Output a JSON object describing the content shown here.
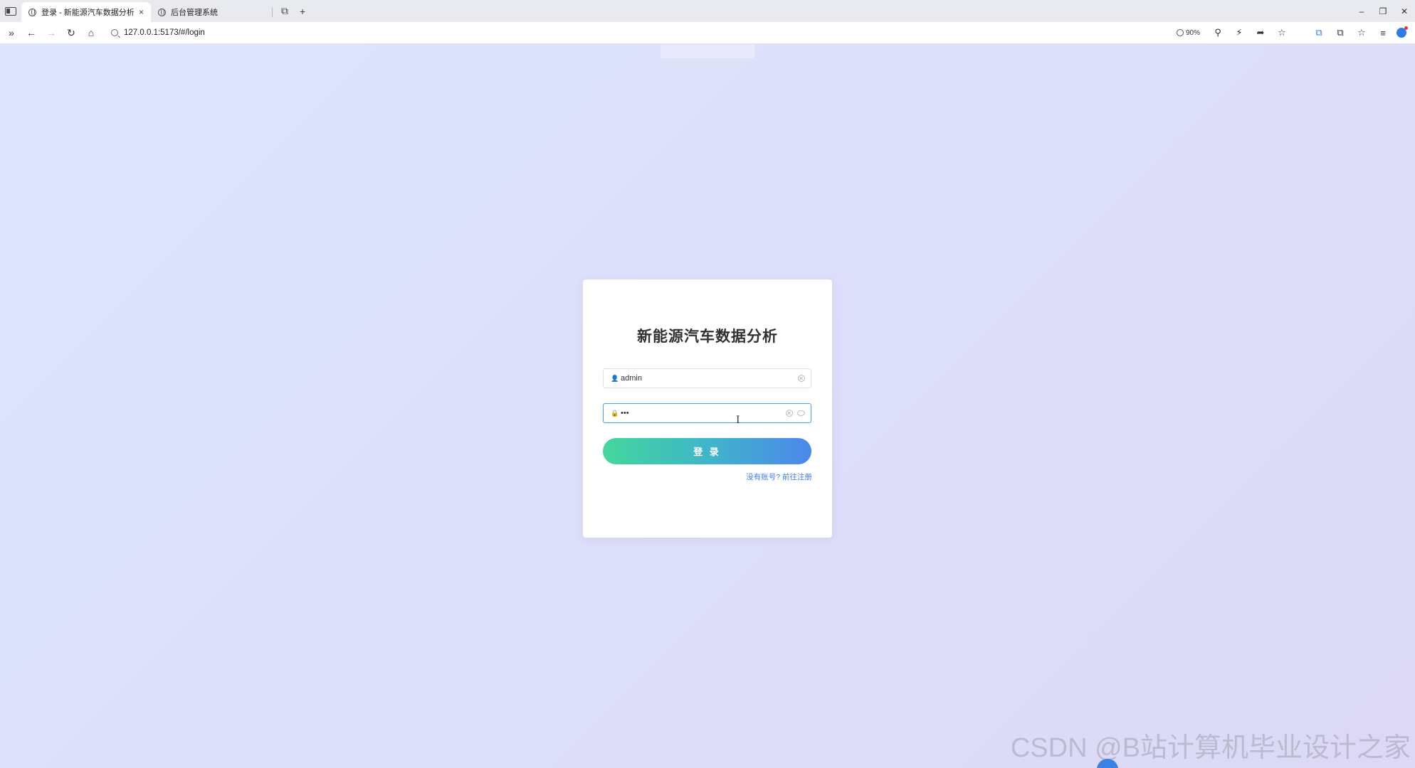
{
  "browser": {
    "tabs": [
      {
        "title": "登录 - 新能源汽车数据分析",
        "active": true
      },
      {
        "title": "后台管理系统",
        "active": false
      }
    ],
    "url": "127.0.0.1:5173/#/login",
    "zoom": "90%",
    "icons": {
      "sidebar": "sidebar-toggle-icon",
      "close": "×",
      "new_tab": "+",
      "tab_overview": "⧉",
      "forward_double": "»",
      "back": "←",
      "forward": "→",
      "reload": "↻",
      "home": "⌂",
      "minimize": "–",
      "restore": "❐",
      "window_close": "✕",
      "pin": "⚲",
      "bolt": "⚡",
      "share": "➦",
      "star_add": "☆",
      "translate": "⧉",
      "extensions": "⧉",
      "favorites": "☆",
      "menu": "≡"
    }
  },
  "login": {
    "title": "新能源汽车数据分析",
    "username_value": "admin",
    "password_value": "•••",
    "submit_label": "登 录",
    "register_link": "没有账号? 前往注册",
    "accent_color": "#409eff",
    "button_gradient": [
      "#44d79c",
      "#4c87eb"
    ]
  },
  "watermark": "CSDN @B站计算机毕业设计之家"
}
